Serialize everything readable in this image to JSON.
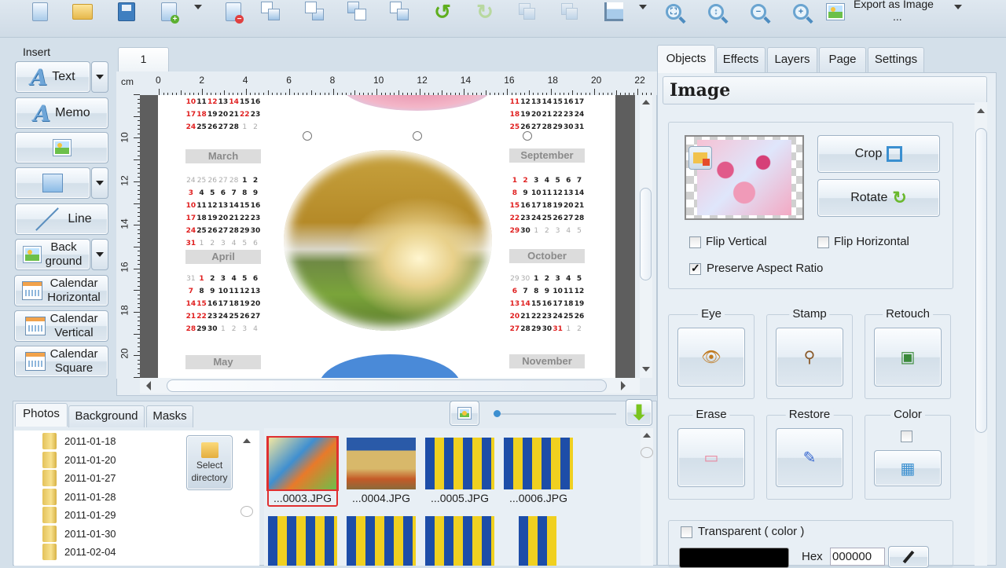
{
  "toolbar": {
    "icons": [
      "new-document",
      "open-folder",
      "save",
      "add-page",
      "remove-page",
      "duplicate-1",
      "duplicate-2",
      "duplicate-3",
      "duplicate-4",
      "undo",
      "redo",
      "group",
      "ungroup",
      "align",
      "zoom-fit",
      "zoom-actual",
      "zoom-out",
      "zoom-in",
      "export-image"
    ],
    "export_label": "Export as Image",
    "export_dots": "..."
  },
  "insert": {
    "title": "Insert",
    "text": "Text",
    "memo": "Memo",
    "line": "Line",
    "background": [
      "Back",
      "ground"
    ],
    "calendar_horizontal": [
      "Calendar",
      "Horizontal"
    ],
    "calendar_vertical": [
      "Calendar",
      "Vertical"
    ],
    "calendar_square": [
      "Calendar",
      "Square"
    ]
  },
  "canvas": {
    "page_tab": "1",
    "ruler_unit": "cm",
    "ruler_h": [
      "0",
      "2",
      "4",
      "6",
      "8",
      "10",
      "12",
      "14",
      "16",
      "18",
      "20",
      "22"
    ],
    "ruler_v": [
      "10",
      "12",
      "14",
      "16",
      "18",
      "20"
    ],
    "months_left": [
      {
        "name": "March",
        "rows": [
          [
            "24",
            "25",
            "26",
            "27",
            "28",
            "1",
            "2"
          ],
          [
            "3",
            "4",
            "5",
            "6",
            "7",
            "8",
            "9"
          ],
          [
            "10",
            "11",
            "12",
            "13",
            "14",
            "15",
            "16"
          ],
          [
            "17",
            "18",
            "19",
            "20",
            "21",
            "22",
            "23"
          ],
          [
            "24",
            "25",
            "26",
            "27",
            "28",
            "29",
            "30"
          ],
          [
            "31",
            "1",
            "2",
            "3",
            "4",
            "5",
            "6"
          ]
        ]
      },
      {
        "name": "April",
        "rows": [
          [
            "31",
            "1",
            "2",
            "3",
            "4",
            "5",
            "6"
          ],
          [
            "7",
            "8",
            "9",
            "10",
            "11",
            "12",
            "13"
          ],
          [
            "14",
            "15",
            "16",
            "17",
            "18",
            "19",
            "20"
          ],
          [
            "21",
            "22",
            "23",
            "24",
            "25",
            "26",
            "27"
          ],
          [
            "28",
            "29",
            "30",
            "1",
            "2",
            "3",
            "4"
          ]
        ]
      },
      {
        "name": "May",
        "rows": []
      }
    ],
    "months_right": [
      {
        "name": "September",
        "rows": [
          [
            "1",
            "2",
            "3",
            "4",
            "5",
            "6",
            "7"
          ],
          [
            "8",
            "9",
            "10",
            "11",
            "12",
            "13",
            "14"
          ],
          [
            "15",
            "16",
            "17",
            "18",
            "19",
            "20",
            "21"
          ],
          [
            "22",
            "23",
            "24",
            "25",
            "26",
            "27",
            "28"
          ],
          [
            "29",
            "30",
            "1",
            "2",
            "3",
            "4",
            "5"
          ]
        ]
      },
      {
        "name": "October",
        "rows": [
          [
            "29",
            "30",
            "1",
            "2",
            "3",
            "4",
            "5"
          ],
          [
            "6",
            "7",
            "8",
            "9",
            "10",
            "11",
            "12"
          ],
          [
            "13",
            "14",
            "15",
            "16",
            "17",
            "18",
            "19"
          ],
          [
            "20",
            "21",
            "22",
            "23",
            "24",
            "25",
            "26"
          ],
          [
            "27",
            "28",
            "29",
            "30",
            "31",
            "1",
            "2"
          ]
        ]
      },
      {
        "name": "November",
        "rows": []
      }
    ],
    "top_left_rows": [
      [
        "10",
        "11",
        "12",
        "13",
        "14",
        "15",
        "16"
      ],
      [
        "17",
        "18",
        "19",
        "20",
        "21",
        "22",
        "23"
      ],
      [
        "24",
        "25",
        "26",
        "27",
        "28",
        "1",
        "2"
      ]
    ],
    "top_right_rows": [
      [
        "11",
        "12",
        "13",
        "14",
        "15",
        "16",
        "17"
      ],
      [
        "18",
        "19",
        "20",
        "21",
        "22",
        "23",
        "24"
      ],
      [
        "25",
        "26",
        "27",
        "28",
        "29",
        "30",
        "31"
      ]
    ]
  },
  "bottom": {
    "tabs": [
      "Photos",
      "Background",
      "Masks"
    ],
    "folders": [
      "2011-01-18",
      "2011-01-20",
      "2011-01-27",
      "2011-01-28",
      "2011-01-29",
      "2011-01-30",
      "2011-02-04"
    ],
    "select_directory": [
      "Select",
      "directory"
    ],
    "thumbnails": [
      "...0003.JPG",
      "...0004.JPG",
      "...0005.JPG",
      "...0006.JPG"
    ]
  },
  "right": {
    "tabs": [
      "Objects",
      "Effects",
      "Layers",
      "Page",
      "Settings"
    ],
    "title": "Image",
    "crop": "Crop",
    "rotate": "Rotate",
    "flip_vertical": "Flip Vertical",
    "flip_horizontal": "Flip Horizontal",
    "preserve_aspect": "Preserve Aspect Ratio",
    "preserve_aspect_checked": true,
    "tools": [
      "Eye",
      "Stamp",
      "Retouch",
      "Erase",
      "Restore",
      "Color"
    ],
    "transparent": "Transparent ( color )",
    "hex_label": "Hex",
    "hex_value": "000000",
    "color_swatch": "#000000"
  }
}
